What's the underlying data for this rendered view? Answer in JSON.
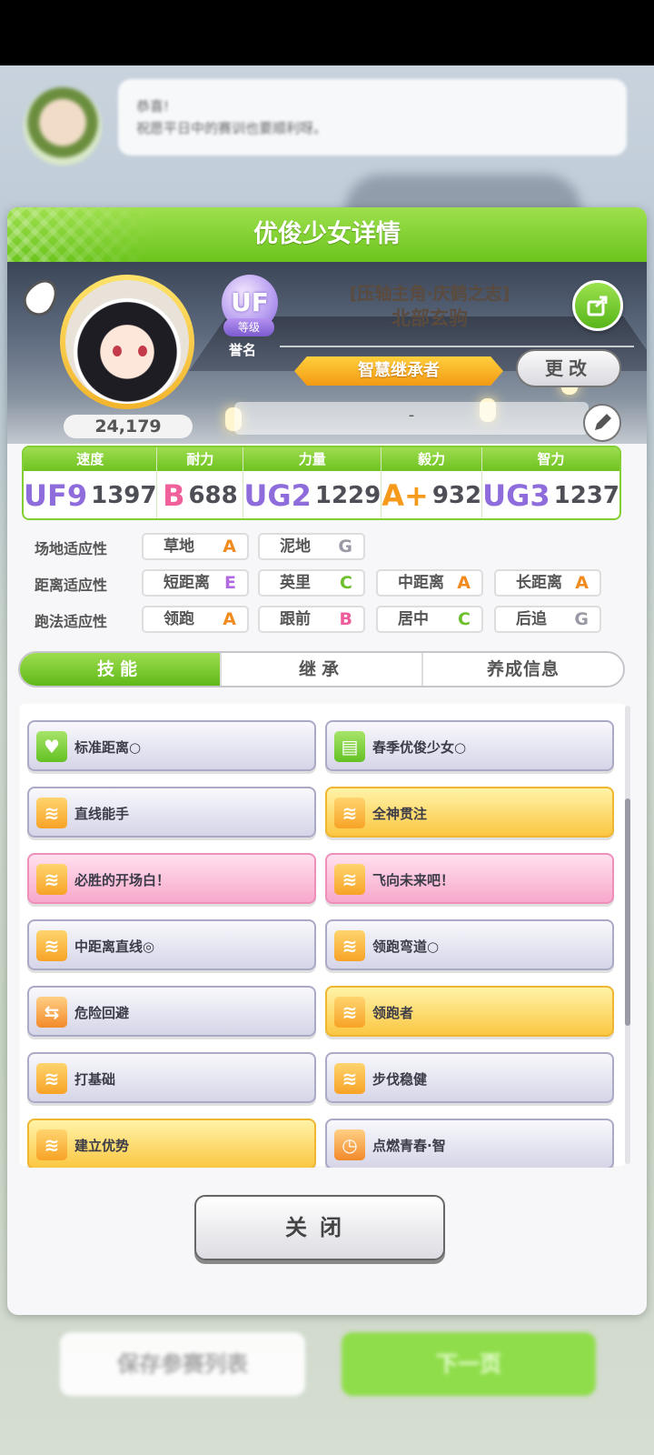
{
  "modal": {
    "title": "优俊少女详情"
  },
  "profile": {
    "fans": "24,179",
    "rank_badge": "UF",
    "rank_tag": "等级",
    "honor_label": "誉名",
    "title": "[压轴主角·庆鹤之志]",
    "name": "北部玄驹",
    "heir_badge": "智慧继承者",
    "change_label": "更改",
    "memo": "-"
  },
  "stats": [
    {
      "label": "速度",
      "grade": "UF9",
      "value": "1397"
    },
    {
      "label": "耐力",
      "grade": "B",
      "value": "688"
    },
    {
      "label": "力量",
      "grade": "UG2",
      "value": "1229"
    },
    {
      "label": "毅力",
      "grade": "A+",
      "value": "932"
    },
    {
      "label": "智力",
      "grade": "UG3",
      "value": "1237"
    }
  ],
  "aptitude": {
    "track": {
      "label": "场地适应性",
      "items": [
        {
          "name": "草地",
          "grade": "A"
        },
        {
          "name": "泥地",
          "grade": "G"
        }
      ]
    },
    "distance": {
      "label": "距离适应性",
      "items": [
        {
          "name": "短距离",
          "grade": "E"
        },
        {
          "name": "英里",
          "grade": "C"
        },
        {
          "name": "中距离",
          "grade": "A"
        },
        {
          "name": "长距离",
          "grade": "A"
        }
      ]
    },
    "style": {
      "label": "跑法适应性",
      "items": [
        {
          "name": "领跑",
          "grade": "A"
        },
        {
          "name": "跟前",
          "grade": "B"
        },
        {
          "name": "居中",
          "grade": "C"
        },
        {
          "name": "后追",
          "grade": "G"
        }
      ]
    }
  },
  "tabs": [
    "技能",
    "继承",
    "养成信息"
  ],
  "skills": [
    {
      "name": "标准距离○",
      "style": "normal",
      "icon": "heart-icon"
    },
    {
      "name": "春季优俊少女○",
      "style": "normal",
      "icon": "card-icon"
    },
    {
      "name": "直线能手",
      "style": "normal",
      "icon": "speed-icon"
    },
    {
      "name": "全神贯注",
      "style": "gold",
      "icon": "speed-icon"
    },
    {
      "name": "必胜的开场白！",
      "style": "pink",
      "icon": "speed-icon"
    },
    {
      "name": "飞向未来吧！",
      "style": "pink",
      "icon": "speed-icon"
    },
    {
      "name": "中距离直线◎",
      "style": "normal",
      "icon": "speed-icon"
    },
    {
      "name": "领跑弯道○",
      "style": "normal",
      "icon": "speed-icon"
    },
    {
      "name": "危险回避",
      "style": "normal",
      "icon": "dodge-icon"
    },
    {
      "name": "领跑者",
      "style": "gold",
      "icon": "speed-icon"
    },
    {
      "name": "打基础",
      "style": "normal",
      "icon": "speed-icon"
    },
    {
      "name": "步伐稳健",
      "style": "normal",
      "icon": "speed-icon"
    },
    {
      "name": "建立优势",
      "style": "gold",
      "icon": "speed-icon"
    },
    {
      "name": "点燃青春·智",
      "style": "normal",
      "icon": "timer-icon"
    }
  ],
  "close_label": "关闭",
  "background": {
    "dialog_line1": "恭喜!",
    "dialog_line2": "祝愿平日中的赛训也要顺利呀。",
    "save_label": "保存参赛列表",
    "next_label": "下一页"
  }
}
